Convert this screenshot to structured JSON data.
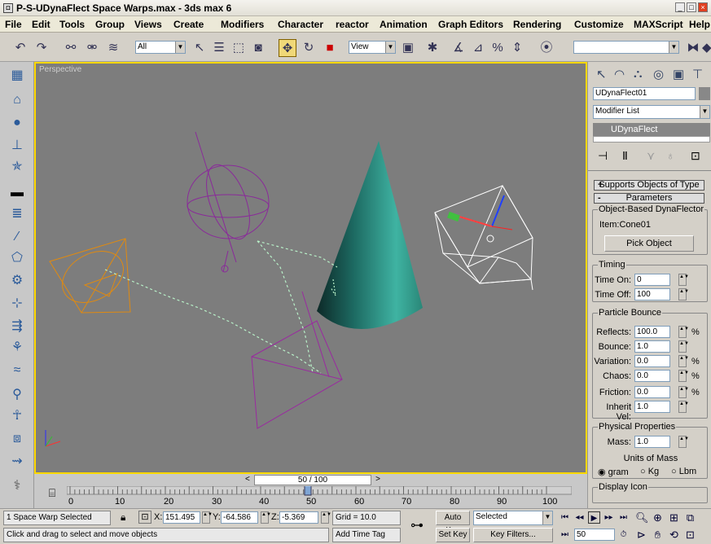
{
  "window": {
    "title": "P-S-UDynaFlect Space Warps.max - 3ds max 6"
  },
  "menu": [
    "File",
    "Edit",
    "Tools",
    "Group",
    "Views",
    "Create",
    "Modifiers",
    "Character",
    "reactor",
    "Animation",
    "Graph Editors",
    "Rendering",
    "Customize",
    "MAXScript",
    "Help"
  ],
  "toolbar": {
    "selection_filter": "All",
    "ref_coord": "View"
  },
  "viewport": {
    "label": "Perspective"
  },
  "timeline": {
    "frame_display": "50 / 100",
    "ticks": [
      "0",
      "10",
      "20",
      "30",
      "40",
      "50",
      "60",
      "70",
      "80",
      "90",
      "100"
    ],
    "current_frame": 50
  },
  "command_panel": {
    "object_name": "UDynaFlect01",
    "modifier_list": "Modifier List",
    "stack_item": "UDynaFlect",
    "rollouts": {
      "supports": "Supports Objects of Type",
      "parameters": "Parameters"
    },
    "object_based": {
      "group_title": "Object-Based DynaFlector",
      "item_label": "Item:Cone01",
      "pick_button": "Pick Object"
    },
    "timing": {
      "group_title": "Timing",
      "time_on_label": "Time On:",
      "time_on": "0",
      "time_off_label": "Time Off:",
      "time_off": "100"
    },
    "particle_bounce": {
      "group_title": "Particle Bounce",
      "reflects_label": "Reflects:",
      "reflects": "100.0",
      "bounce_label": "Bounce:",
      "bounce": "1.0",
      "variation_label": "Variation:",
      "variation": "0.0",
      "chaos_label": "Chaos:",
      "chaos": "0.0",
      "friction_label": "Friction:",
      "friction": "0.0",
      "inherit_label": "Inherit Vel:",
      "inherit": "1.0",
      "pct": "%"
    },
    "physical": {
      "group_title": "Physical Properties",
      "mass_label": "Mass:",
      "mass": "1.0",
      "units_label": "Units of Mass",
      "unit_gram": "gram",
      "unit_kg": "Kg",
      "unit_lbm": "Lbm"
    },
    "display_icon": "Display Icon"
  },
  "status": {
    "selection": "1 Space Warp Selected",
    "prompt": "Click and drag to select and move objects",
    "x_label": "X:",
    "x": "151.495",
    "y_label": "Y:",
    "y": "-64.586",
    "z_label": "Z:",
    "z": "-5.369",
    "grid": "Grid = 10.0",
    "add_time_tag": "Add Time Tag",
    "auto_key": "Auto Key",
    "set_key": "Set Key",
    "selected": "Selected",
    "key_filters": "Key Filters...",
    "frame": "50"
  }
}
